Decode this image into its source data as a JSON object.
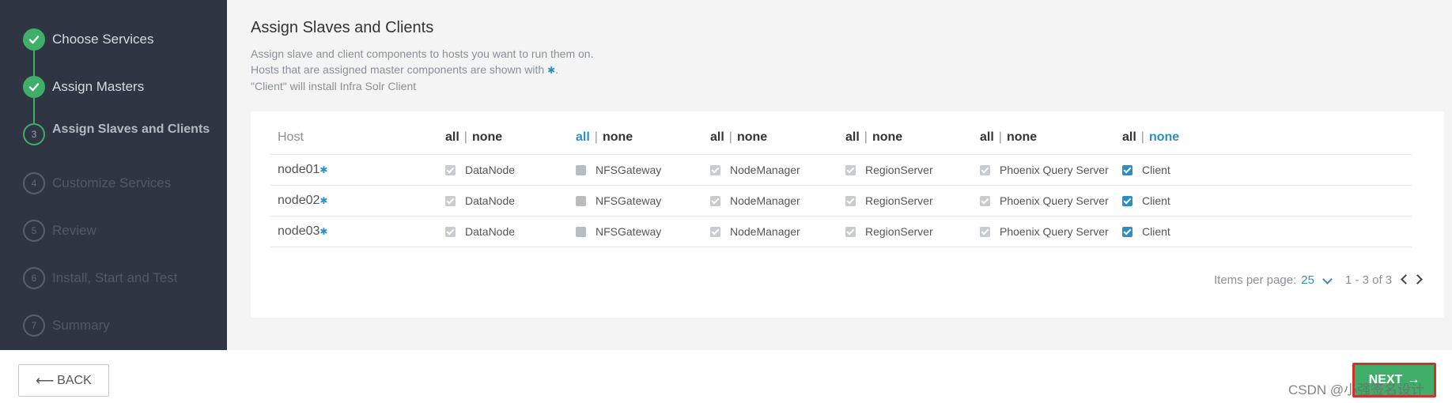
{
  "wizard": {
    "steps": [
      {
        "number": "1",
        "label": "Choose Services",
        "state": "done"
      },
      {
        "number": "2",
        "label": "Assign Masters",
        "state": "done"
      },
      {
        "number": "3",
        "label": "Assign Slaves and Clients",
        "state": "current"
      },
      {
        "number": "4",
        "label": "Customize Services",
        "state": "pending"
      },
      {
        "number": "5",
        "label": "Review",
        "state": "pending"
      },
      {
        "number": "6",
        "label": "Install, Start and Test",
        "state": "pending"
      },
      {
        "number": "7",
        "label": "Summary",
        "state": "pending"
      }
    ]
  },
  "page": {
    "title": "Assign Slaves and Clients",
    "desc_line1": "Assign slave and client components to hosts you want to run them on.",
    "desc_line2_prefix": "Hosts that are assigned master components are shown with ",
    "desc_line2_suffix": ".",
    "desc_line3": "\"Client\" will install Infra Solr Client",
    "master_marker": "✱"
  },
  "table": {
    "host_header": "Host",
    "all_label": "all",
    "none_label": "none",
    "sep": "|",
    "columns": [
      {
        "component": "DataNode",
        "active": ""
      },
      {
        "component": "NFSGateway",
        "active": "all"
      },
      {
        "component": "NodeManager",
        "active": ""
      },
      {
        "component": "RegionServer",
        "active": ""
      },
      {
        "component": "Phoenix Query Server",
        "active": ""
      },
      {
        "component": "Client",
        "active": "none"
      }
    ],
    "rows": [
      {
        "host": "node01",
        "states": [
          "checked-grey",
          "empty-grey",
          "checked-grey",
          "checked-grey",
          "checked-grey",
          "checked-blue"
        ]
      },
      {
        "host": "node02",
        "states": [
          "checked-grey",
          "empty-grey",
          "checked-grey",
          "checked-grey",
          "checked-grey",
          "checked-blue"
        ]
      },
      {
        "host": "node03",
        "states": [
          "checked-grey",
          "empty-grey",
          "checked-grey",
          "checked-grey",
          "checked-grey",
          "checked-blue"
        ]
      }
    ]
  },
  "pagination": {
    "items_per_page_label": "Items per page:",
    "items_per_page_value": "25",
    "range": "1 - 3 of 3"
  },
  "footer": {
    "back_label": "BACK",
    "back_arrow": "⟵",
    "next_label": "NEXT",
    "next_arrow": "→",
    "watermark": "CSDN @小强签名设计"
  },
  "colors": {
    "accent_green": "#3fae68",
    "link_blue": "#2b8fc4",
    "sidebar_bg": "#2f3542",
    "highlight_red": "#d0312d"
  }
}
